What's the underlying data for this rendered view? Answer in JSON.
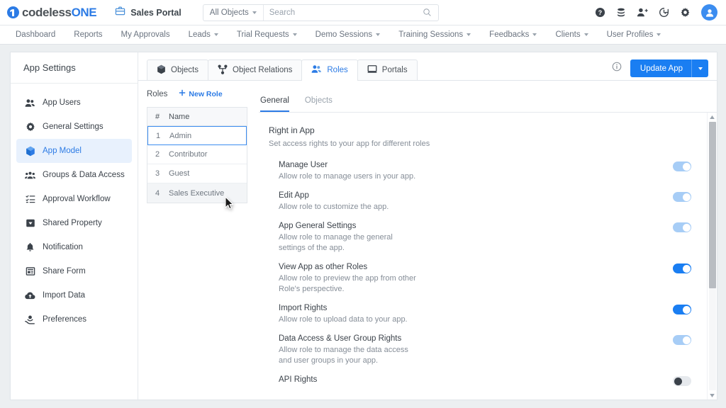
{
  "topbar": {
    "logo_part1": "codeless",
    "logo_part2": "ONE",
    "portal_name": "Sales Portal",
    "search": {
      "scope_label": "All Objects",
      "placeholder": "Search",
      "value": ""
    },
    "icons": [
      "help-icon",
      "database-icon",
      "add-user-icon",
      "history-icon",
      "gear-icon",
      "avatar"
    ]
  },
  "nav": {
    "items": [
      {
        "label": "Dashboard",
        "has_caret": false
      },
      {
        "label": "Reports",
        "has_caret": false
      },
      {
        "label": "My Approvals",
        "has_caret": false
      },
      {
        "label": "Leads",
        "has_caret": true
      },
      {
        "label": "Trial Requests",
        "has_caret": true
      },
      {
        "label": "Demo Sessions",
        "has_caret": true
      },
      {
        "label": "Training Sessions",
        "has_caret": true
      },
      {
        "label": "Feedbacks",
        "has_caret": true
      },
      {
        "label": "Clients",
        "has_caret": true
      },
      {
        "label": "User Profiles",
        "has_caret": true
      }
    ]
  },
  "sidebar": {
    "title": "App Settings",
    "items": [
      {
        "label": "App Users",
        "icon": "users-icon",
        "active": false
      },
      {
        "label": "General Settings",
        "icon": "gear-icon",
        "active": false
      },
      {
        "label": "App Model",
        "icon": "cube-icon",
        "active": true
      },
      {
        "label": "Groups & Data Access",
        "icon": "group-icon",
        "active": false
      },
      {
        "label": "Approval Workflow",
        "icon": "checklist-icon",
        "active": false
      },
      {
        "label": "Shared Property",
        "icon": "tag-icon",
        "active": false
      },
      {
        "label": "Notification",
        "icon": "bell-icon",
        "active": false
      },
      {
        "label": "Share Form",
        "icon": "form-icon",
        "active": false
      },
      {
        "label": "Import Data",
        "icon": "cloud-upload-icon",
        "active": false
      },
      {
        "label": "Preferences",
        "icon": "preferences-icon",
        "active": false
      }
    ]
  },
  "tabs": [
    {
      "label": "Objects",
      "icon": "cube-icon",
      "active": false
    },
    {
      "label": "Object Relations",
      "icon": "relations-icon",
      "active": false
    },
    {
      "label": "Roles",
      "icon": "roles-icon",
      "active": true
    },
    {
      "label": "Portals",
      "icon": "portal-icon",
      "active": false
    }
  ],
  "actions": {
    "info_icon": "info-icon",
    "update_app_label": "Update App"
  },
  "roles_panel": {
    "title": "Roles",
    "new_role_label": "New Role",
    "columns": [
      "#",
      "Name"
    ],
    "rows": [
      {
        "num": "1",
        "name": "Admin",
        "state": "selected"
      },
      {
        "num": "2",
        "name": "Contributor",
        "state": "normal"
      },
      {
        "num": "3",
        "name": "Guest",
        "state": "normal"
      },
      {
        "num": "4",
        "name": "Sales Executive",
        "state": "hovered"
      }
    ]
  },
  "detail": {
    "subtabs": [
      {
        "label": "General",
        "active": true
      },
      {
        "label": "Objects",
        "active": false
      }
    ],
    "section_title": "Right in App",
    "section_subtitle": "Set access rights to your app for different roles",
    "rights": [
      {
        "label": "Manage User",
        "description": "Allow role to manage users in your app.",
        "toggle": "on-light"
      },
      {
        "label": "Edit App",
        "description": "Allow role to customize the app.",
        "toggle": "on-light"
      },
      {
        "label": "App General Settings",
        "description": "Allow role to manage the general settings of the app.",
        "toggle": "on-light"
      },
      {
        "label": "View App as other Roles",
        "description": "Allow role to preview the app from other Role's perspective.",
        "toggle": "on-strong"
      },
      {
        "label": "Import Rights",
        "description": "Allow role to upload data to your app.",
        "toggle": "on-strong"
      },
      {
        "label": "Data Access & User Group Rights",
        "description": "Allow role to manage the data access and user groups in your app.",
        "toggle": "on-light"
      },
      {
        "label": "API Rights",
        "description": "",
        "toggle": "off-dark"
      }
    ],
    "scrollbar": {
      "thumb_percent": 62
    }
  },
  "colors": {
    "accent": "#2c7be5",
    "accent_button": "#1a7ef2",
    "toggle_light": "#a7cdf6",
    "page_bg": "#eceff1",
    "text_dark": "#3b424a",
    "text_muted": "#868e98"
  }
}
